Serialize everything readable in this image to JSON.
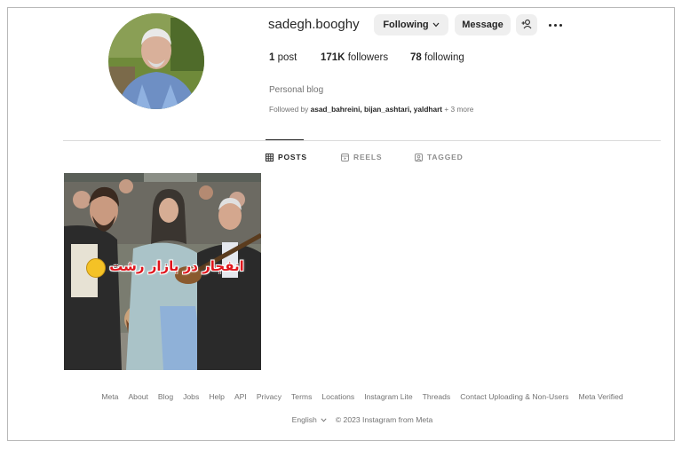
{
  "profile": {
    "username": "sadegh.booghy",
    "following_button": "Following",
    "message_button": "Message",
    "stats": {
      "posts_count": "1",
      "posts_label": "post",
      "followers_count": "171K",
      "followers_label": "followers",
      "following_count": "78",
      "following_label": "following"
    },
    "category": "Personal blog",
    "followed_by_prefix": "Followed by",
    "followed_by_names": "asad_bahreini, bijan_ashtari, yaldhart",
    "followed_by_more": "+ 3 more"
  },
  "tabs": [
    {
      "label": "POSTS",
      "icon": "grid-icon",
      "active": true
    },
    {
      "label": "REELS",
      "icon": "reels-icon",
      "active": false
    },
    {
      "label": "TAGGED",
      "icon": "tagged-icon",
      "active": false
    }
  ],
  "posts": [
    {
      "caption": "انفجار در بازار رشت",
      "emoji": "😱"
    }
  ],
  "footer": {
    "links": [
      "Meta",
      "About",
      "Blog",
      "Jobs",
      "Help",
      "API",
      "Privacy",
      "Terms",
      "Locations",
      "Instagram Lite",
      "Threads",
      "Contact Uploading & Non-Users",
      "Meta Verified"
    ],
    "language": "English",
    "copyright": "© 2023 Instagram from Meta"
  },
  "colors": {
    "button_bg": "#efefef",
    "text_primary": "#262626",
    "text_secondary": "#737373",
    "caption_red": "#e0151c"
  }
}
